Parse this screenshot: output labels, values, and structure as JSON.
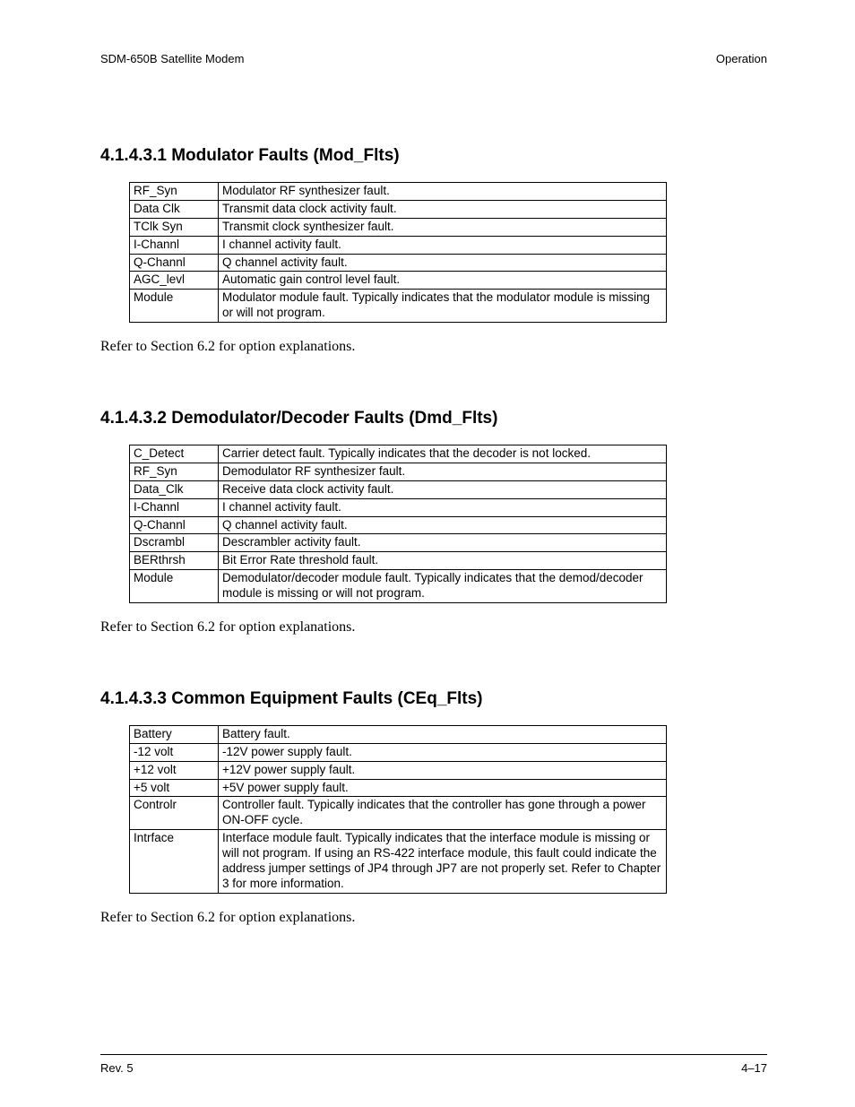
{
  "header": {
    "left": "SDM-650B Satellite Modem",
    "right": "Operation"
  },
  "footer": {
    "left": "Rev. 5",
    "right": "4–17"
  },
  "sections": [
    {
      "heading": "4.1.4.3.1  Modulator Faults (Mod_Flts)",
      "rows": [
        [
          "RF_Syn",
          "Modulator RF synthesizer fault."
        ],
        [
          "Data Clk",
          "Transmit data clock activity fault."
        ],
        [
          "TClk Syn",
          "Transmit clock synthesizer fault."
        ],
        [
          "I-Channl",
          "I channel activity fault."
        ],
        [
          "Q-Channl",
          "Q channel activity fault."
        ],
        [
          "AGC_levl",
          "Automatic gain control level fault."
        ],
        [
          "Module",
          "Modulator module fault. Typically indicates that the modulator module is missing or will not program."
        ]
      ],
      "note": "Refer to Section 6.2 for option explanations."
    },
    {
      "heading": "4.1.4.3.2  Demodulator/Decoder Faults (Dmd_Flts)",
      "rows": [
        [
          "C_Detect",
          "Carrier detect fault. Typically indicates that the decoder is not locked."
        ],
        [
          "RF_Syn",
          "Demodulator RF synthesizer fault."
        ],
        [
          "Data_Clk",
          "Receive data clock activity fault."
        ],
        [
          "I-Channl",
          "I channel activity fault."
        ],
        [
          "Q-Channl",
          "Q channel activity fault."
        ],
        [
          "Dscrambl",
          "Descrambler activity fault."
        ],
        [
          "BERthrsh",
          "Bit Error Rate threshold fault."
        ],
        [
          "Module",
          "Demodulator/decoder module fault. Typically indicates that the demod/decoder module is missing or will not program."
        ]
      ],
      "note": "Refer to Section 6.2 for option explanations."
    },
    {
      "heading": "4.1.4.3.3  Common Equipment Faults (CEq_Flts)",
      "rows": [
        [
          "Battery",
          "Battery fault."
        ],
        [
          "-12 volt",
          "-12V power supply fault."
        ],
        [
          "+12 volt",
          "+12V power supply fault."
        ],
        [
          "+5 volt",
          "+5V power supply fault."
        ],
        [
          "Controlr",
          "Controller fault. Typically indicates that the controller has gone through a power ON-OFF cycle."
        ],
        [
          "Intrface",
          "Interface module fault. Typically indicates that the interface module is missing or will not program. If using an RS-422 interface module, this fault could indicate the address jumper settings of JP4 through JP7 are not properly set. Refer to Chapter 3 for more information."
        ]
      ],
      "note": "Refer to Section 6.2 for option explanations."
    }
  ]
}
